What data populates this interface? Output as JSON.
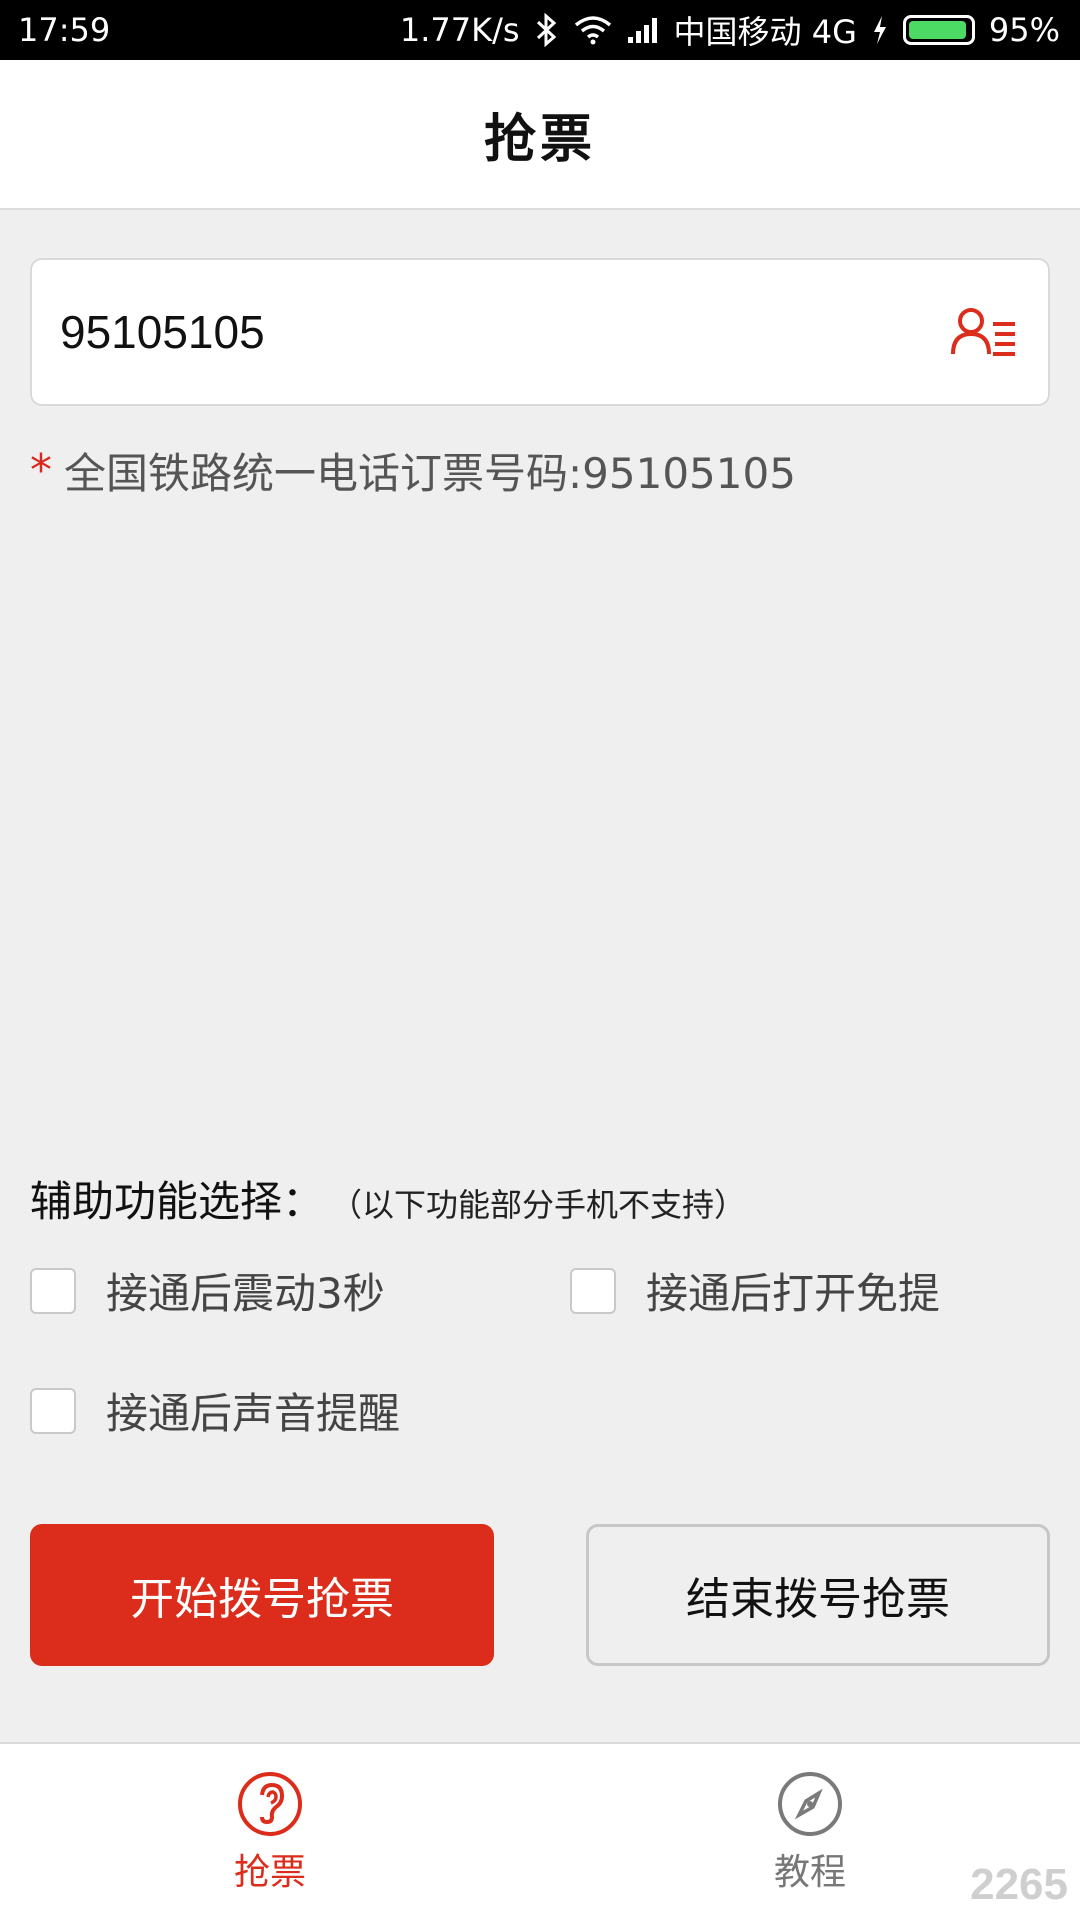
{
  "status_bar": {
    "time": "17:59",
    "net_speed": "1.77K/s",
    "carrier": "中国移动 4G",
    "battery": "95%",
    "battery_level_pct": 95,
    "battery_color": "#4cd964"
  },
  "header": {
    "title": "抢票"
  },
  "phone": {
    "value": "95105105",
    "contact_icon": "contact-list-icon",
    "icon_color": "#dc2c1b"
  },
  "hint": {
    "star": "*",
    "text": "全国铁路统一电话订票号码:95105105"
  },
  "assist": {
    "title": "辅助功能选择：",
    "note": "（以下功能部分手机不支持）",
    "options": [
      {
        "label": "接通后震动3秒",
        "checked": false
      },
      {
        "label": "接通后打开免提",
        "checked": false
      },
      {
        "label": "接通后声音提醒",
        "checked": false
      }
    ]
  },
  "buttons": {
    "start": "开始拨号抢票",
    "end": "结束拨号抢票"
  },
  "bottom_nav": {
    "items": [
      {
        "label": "抢票",
        "icon": "ear-icon",
        "active": true
      },
      {
        "label": "教程",
        "icon": "compass-icon",
        "active": false
      }
    ]
  },
  "watermark": "2265",
  "colors": {
    "accent": "#dc2c1b",
    "background": "#efefef"
  }
}
